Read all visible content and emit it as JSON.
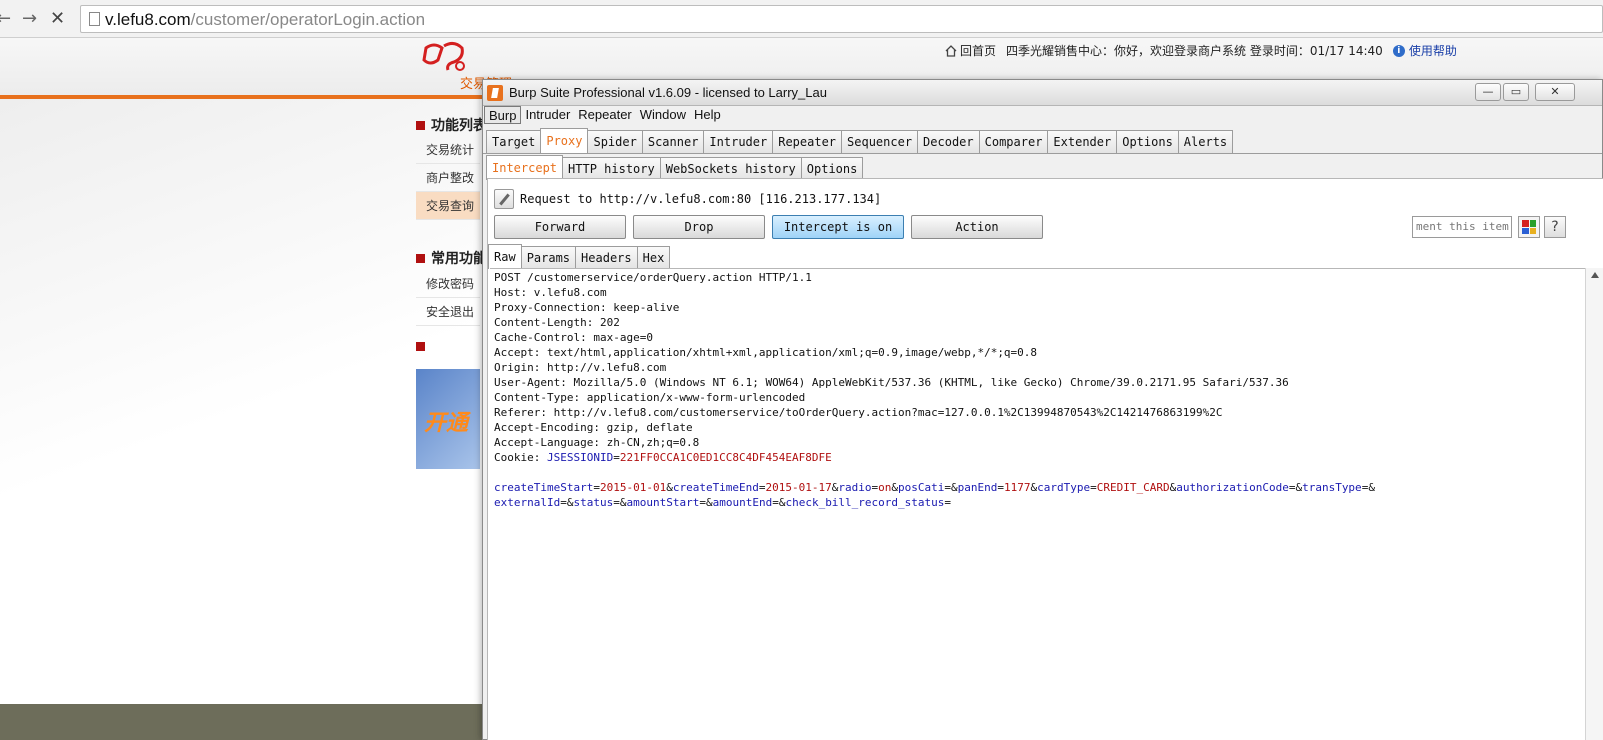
{
  "browser": {
    "url_host": "v.lefu8.com",
    "url_path": "/customer/operatorLogin.action",
    "back_glyph": "←",
    "forward_glyph": "→",
    "stop_glyph": "✕"
  },
  "site": {
    "logo_text": "交易管理",
    "home_link": "回首页",
    "greeting": "四季光耀销售中心：你好，欢迎登录商户系统 登录时间：01/17 14:40",
    "help_link": "使用帮助",
    "sections": [
      {
        "title": "功能列表",
        "items": [
          "交易统计",
          "商户整改",
          "交易查询"
        ]
      },
      {
        "title": "常用功能",
        "items": [
          "修改密码",
          "安全退出"
        ]
      }
    ],
    "banner_text": "开通",
    "active_item": "交易查询"
  },
  "burp": {
    "title": "Burp Suite Professional v1.6.09 - licensed to Larry_Lau",
    "window_controls": [
      "▭",
      "▭",
      "✕"
    ],
    "menu": [
      "Burp",
      "Intruder",
      "Repeater",
      "Window",
      "Help"
    ],
    "tabs": [
      "Target",
      "Proxy",
      "Spider",
      "Scanner",
      "Intruder",
      "Repeater",
      "Sequencer",
      "Decoder",
      "Comparer",
      "Extender",
      "Options",
      "Alerts"
    ],
    "active_tab": "Proxy",
    "sub_tabs": [
      "Intercept",
      "HTTP history",
      "WebSockets history",
      "Options"
    ],
    "active_sub_tab": "Intercept",
    "request_label": "Request to http://v.lefu8.com:80  [116.213.177.134]",
    "buttons": {
      "forward": "Forward",
      "drop": "Drop",
      "intercept": "Intercept is on",
      "action": "Action"
    },
    "comment_placeholder": "ment this item",
    "help_glyph": "?",
    "color_swatches": [
      "#d42020",
      "#2aa02a",
      "#2a5fd4",
      "#e8b020"
    ],
    "view_tabs": [
      "Raw",
      "Params",
      "Headers",
      "Hex"
    ],
    "active_view_tab": "Raw",
    "request_lines": [
      "POST /customerservice/orderQuery.action HTTP/1.1",
      "Host: v.lefu8.com",
      "Proxy-Connection: keep-alive",
      "Content-Length: 202",
      "Cache-Control: max-age=0",
      "Accept: text/html,application/xhtml+xml,application/xml;q=0.9,image/webp,*/*;q=0.8",
      "Origin: http://v.lefu8.com",
      "User-Agent: Mozilla/5.0 (Windows NT 6.1; WOW64) AppleWebKit/537.36 (KHTML, like Gecko) Chrome/39.0.2171.95 Safari/537.36",
      "Content-Type: application/x-www-form-urlencoded",
      "Referer: http://v.lefu8.com/customerservice/toOrderQuery.action?mac=127.0.0.1%2C13994870543%2C1421476863199%2C",
      "Accept-Encoding: gzip, deflate",
      "Accept-Language: zh-CN,zh;q=0.8"
    ],
    "cookie": {
      "label": "Cookie: ",
      "name": "JSESSIONID",
      "value": "221FF0CCA1C0ED1CC8C4DF454EAF8DFE"
    },
    "body_params_line1": [
      {
        "name": "createTimeStart",
        "value": "2015-01-01"
      },
      {
        "name": "createTimeEnd",
        "value": "2015-01-17"
      },
      {
        "name": "radio",
        "value": "on"
      },
      {
        "name": "posCati",
        "value": ""
      },
      {
        "name": "panEnd",
        "value": "1177"
      },
      {
        "name": "cardType",
        "value": "CREDIT_CARD"
      },
      {
        "name": "authorizationCode",
        "value": ""
      },
      {
        "name": "transType",
        "value": ""
      }
    ],
    "body_params_line2": [
      {
        "name": "externalId",
        "value": ""
      },
      {
        "name": "status",
        "value": ""
      },
      {
        "name": "amountStart",
        "value": ""
      },
      {
        "name": "amountEnd",
        "value": ""
      },
      {
        "name": "check_bill_record_status",
        "value": ""
      }
    ]
  }
}
